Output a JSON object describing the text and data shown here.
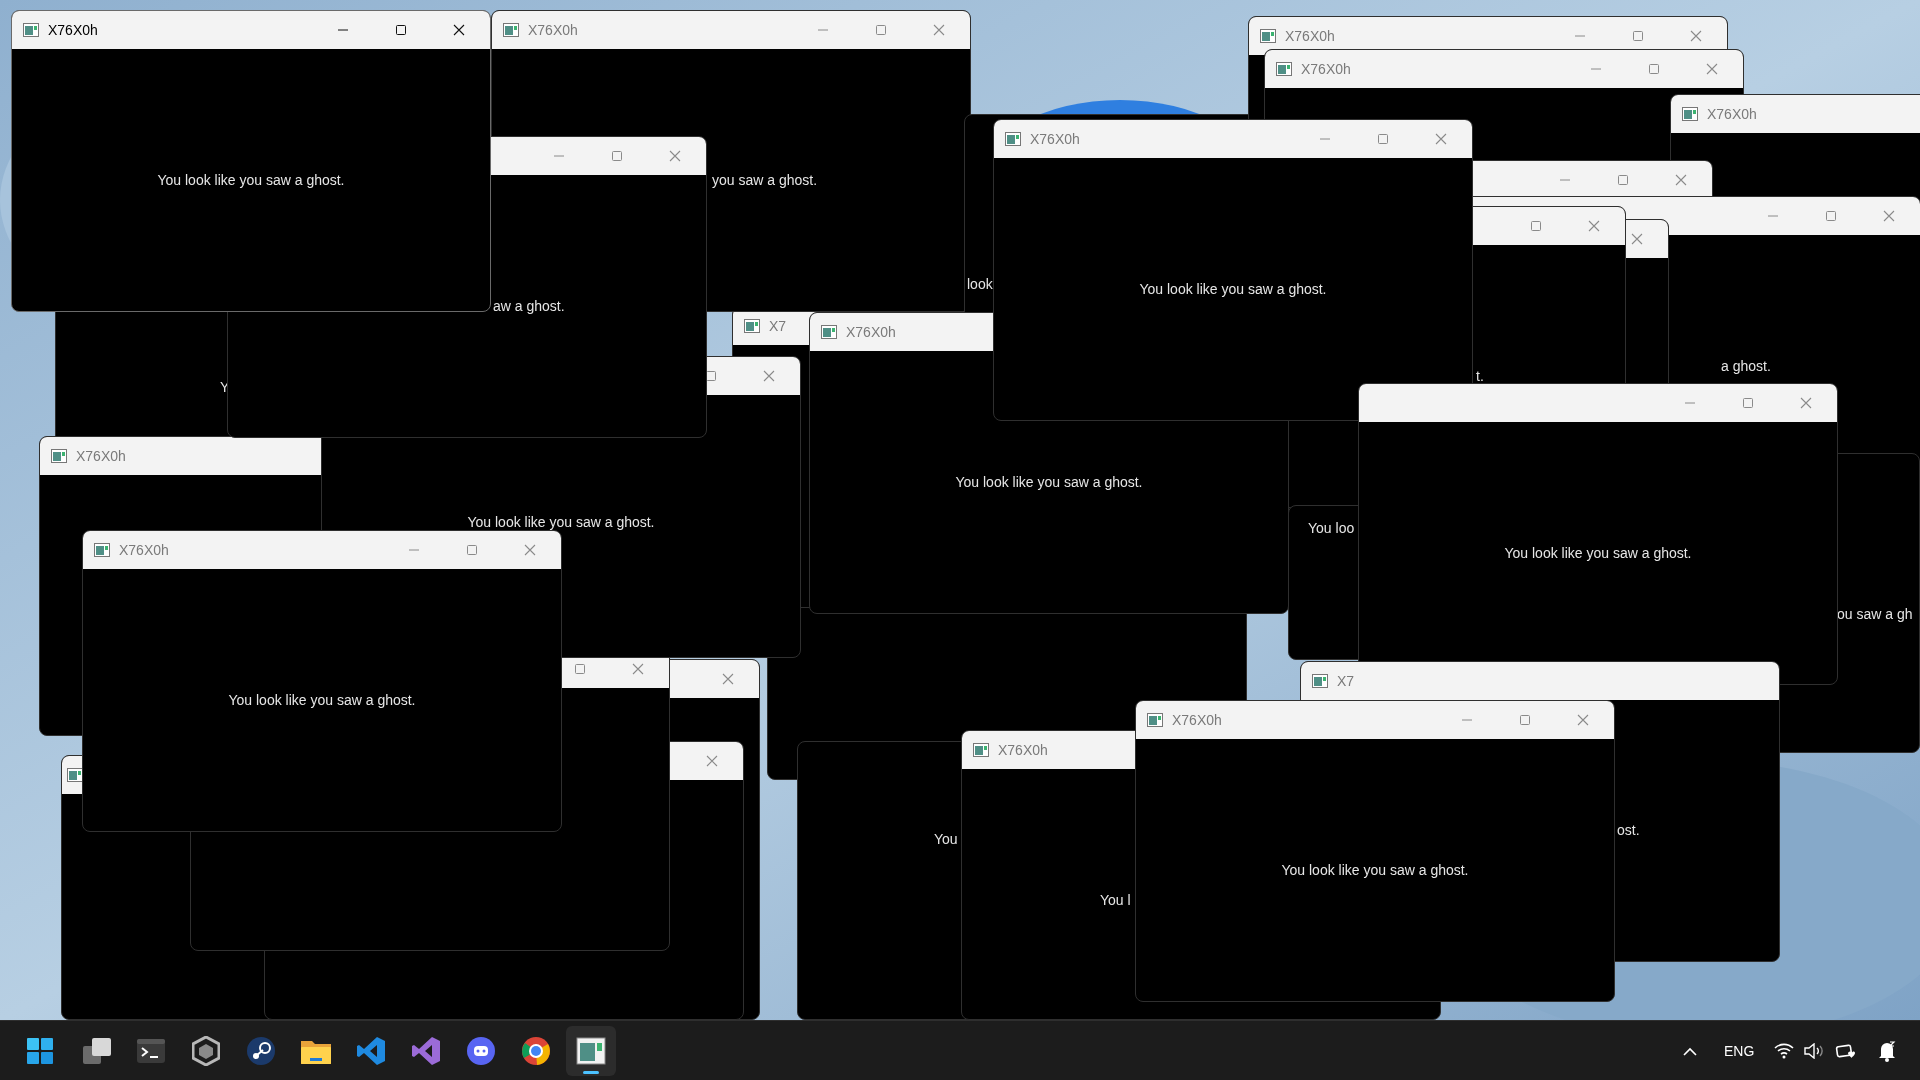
{
  "windows": [
    {
      "active": true,
      "title": "X76X0h",
      "message": "You look like you saw a ghost."
    },
    {
      "active": false,
      "title": "X76X0h",
      "message": "you saw a ghost."
    },
    {
      "active": false,
      "title": "X76X0h"
    },
    {
      "active": false,
      "title": "X76X0h"
    },
    {
      "active": false,
      "title": "X76X0h"
    },
    {
      "active": false,
      "message": "look"
    },
    {
      "active": false,
      "title": "X76X0h",
      "message": "You look like you saw a ghost."
    },
    {
      "active": false,
      "message": "aw a ghost."
    },
    {
      "active": false
    },
    {
      "active": false,
      "message": "a ghost."
    },
    {
      "active": false,
      "message": "t."
    },
    {
      "active": false
    },
    {
      "active": false,
      "title": "X7"
    },
    {
      "active": false,
      "message": "Y"
    },
    {
      "active": false,
      "title": "X76X0h",
      "message": "You look like you saw a ghost."
    },
    {
      "active": false,
      "message": "You look like you saw a ghost."
    },
    {
      "active": false,
      "message": "You look like you saw a ghost."
    },
    {
      "active": false,
      "title": "X76X0h"
    },
    {
      "active": false,
      "message": "ou saw a gh"
    },
    {
      "active": false,
      "message": "You loo"
    },
    {
      "active": false
    },
    {
      "active": false,
      "title": "X76X0h",
      "message": "You look like you saw a ghost."
    },
    {
      "active": false
    },
    {
      "active": false
    },
    {
      "active": false,
      "title": "X7",
      "message": "ost."
    },
    {
      "active": false,
      "title": "X76X0h",
      "message": "You look like you saw a ghost."
    },
    {
      "active": false,
      "title": "X76X0h",
      "message": "You l"
    },
    {
      "active": false
    },
    {
      "active": false,
      "message": "You"
    },
    {
      "active": false
    }
  ],
  "taskbar": {
    "apps": [
      {
        "selected": false
      },
      {
        "selected": false
      },
      {
        "selected": false
      },
      {
        "selected": false
      },
      {
        "selected": false
      },
      {
        "selected": false
      },
      {
        "selected": false
      },
      {
        "selected": false
      },
      {
        "selected": false
      },
      {
        "selected": false
      },
      {
        "selected": true
      }
    ],
    "tray": {
      "language": "ENG"
    }
  }
}
